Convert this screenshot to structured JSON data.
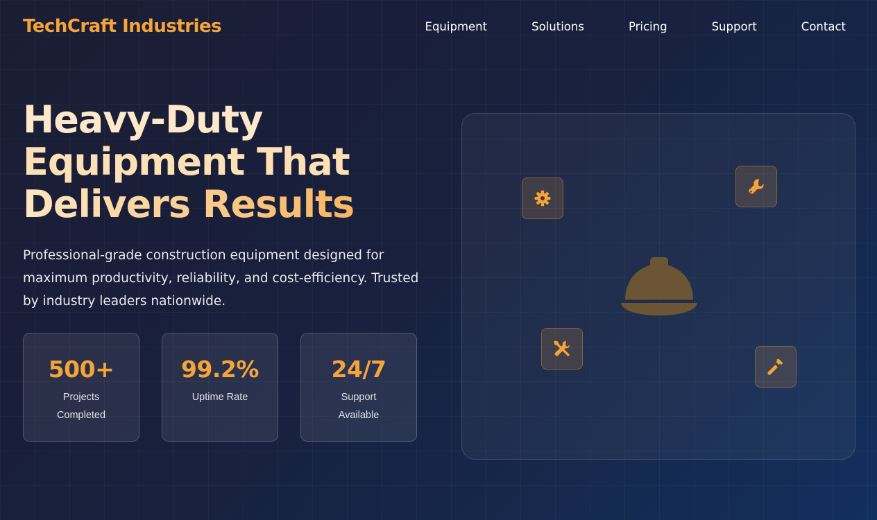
{
  "brand": {
    "name": "TechCraft Industries"
  },
  "nav": {
    "items": [
      {
        "label": "Equipment"
      },
      {
        "label": "Solutions"
      },
      {
        "label": "Pricing"
      },
      {
        "label": "Support"
      },
      {
        "label": "Contact"
      }
    ]
  },
  "hero": {
    "title_line1": "Heavy-Duty",
    "title_line2": "Equipment That",
    "title_line3": "Delivers Results",
    "description": "Professional-grade construction equipment designed for maximum productivity, reliability, and cost-efficiency. Trusted by industry leaders nationwide."
  },
  "stats": [
    {
      "value": "500+",
      "label": "Projects Completed"
    },
    {
      "value": "99.2%",
      "label": "Uptime Rate"
    },
    {
      "value": "24/7",
      "label": "Support Available"
    }
  ],
  "illustration": {
    "center_icon": "hard-hat-icon",
    "tool_icons": [
      "gear-icon",
      "wrench-icon",
      "tools-icon",
      "hammer-icon"
    ]
  },
  "colors": {
    "accent": "#f5a43a",
    "background_start": "#1b1d33",
    "background_end": "#12305e"
  }
}
